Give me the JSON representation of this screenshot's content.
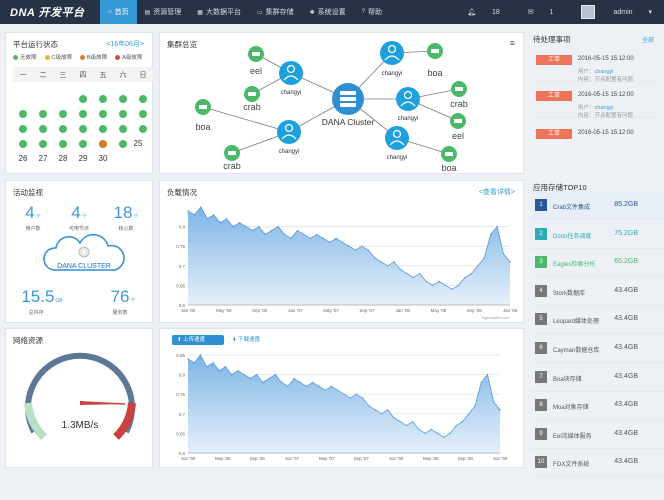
{
  "brand": {
    "logo": "DNA 开发平台"
  },
  "nav": [
    {
      "label": "首页",
      "icon": "home-icon"
    },
    {
      "label": "资源管理",
      "icon": "server-icon"
    },
    {
      "label": "大数据平台",
      "icon": "grid-icon"
    },
    {
      "label": "集群存储",
      "icon": "storage-icon"
    },
    {
      "label": "系统设置",
      "icon": "gear-icon"
    },
    {
      "label": "帮助",
      "icon": "help-icon"
    }
  ],
  "topbar": {
    "notifications": "18",
    "messages": "1",
    "user": "admin"
  },
  "calendar": {
    "title": "平台运行状态",
    "month": "<16年06月>",
    "legend": [
      "无故障",
      "C级故障",
      "B级故障",
      "A级故障"
    ],
    "legend_colors": [
      "#4cb96a",
      "#f2b035",
      "#e07b2a",
      "#d64b3b"
    ],
    "weekdays": [
      "一",
      "二",
      "三",
      "四",
      "五",
      "六",
      "日"
    ],
    "numbers": [
      "25",
      "26",
      "27",
      "28",
      "29",
      "30"
    ]
  },
  "cluster": {
    "title": "集群总览",
    "center": "DANA Cluster",
    "node_labels": [
      "changyi",
      "changyi",
      "changyi",
      "changyi",
      "changyi"
    ],
    "leaf_labels": [
      "eel",
      "crab",
      "boa",
      "crab",
      "boa",
      "crab",
      "eel",
      "boa"
    ]
  },
  "todo": {
    "title": "待处理事项",
    "more": "全部",
    "items": [
      {
        "badge": "工单",
        "date": "2016-05-15 15:12:00",
        "user_label": "用户：",
        "user": "changyi",
        "content": "内容：节点配置有问题"
      },
      {
        "badge": "工单",
        "date": "2016-05-15 15:12:00",
        "user_label": "用户：",
        "user": "changyi",
        "content": "内容：节点配置有问题"
      },
      {
        "badge": "工单",
        "date": "2016-05-15 15:12:00"
      }
    ]
  },
  "activity": {
    "title": "活动监视",
    "stats": [
      {
        "value": "4",
        "unit": "个",
        "label": "用户数"
      },
      {
        "value": "4",
        "unit": "个",
        "label": "可用节点"
      },
      {
        "value": "18",
        "unit": "个",
        "label": "核心数"
      },
      {
        "value": "15.5",
        "unit": "GB",
        "label": "总内存"
      },
      {
        "value": "76",
        "unit": "个",
        "label": "服务数"
      }
    ],
    "cloud_label": "DANA CLUSTER"
  },
  "load": {
    "title": "负载情况",
    "link": "<查看详情>",
    "credit": "highcharts.com"
  },
  "chart_data": [
    {
      "type": "area",
      "title": "负载情况",
      "x_ticks": [
        "Jan '06",
        "May '06",
        "Sep '06",
        "Jan '07",
        "May '07",
        "Sep '07",
        "Jan '08",
        "May '08",
        "Sep '08",
        "Jan '09"
      ],
      "yticks": [
        "0.8",
        "0.75",
        "0.7",
        "0.65",
        "0.6"
      ],
      "ylim": [
        0.6,
        0.85
      ],
      "values": [
        0.84,
        0.83,
        0.85,
        0.82,
        0.83,
        0.81,
        0.82,
        0.8,
        0.81,
        0.8,
        0.79,
        0.8,
        0.78,
        0.79,
        0.8,
        0.78,
        0.77,
        0.79,
        0.78,
        0.77,
        0.78,
        0.77,
        0.76,
        0.77,
        0.76,
        0.75,
        0.74,
        0.75,
        0.74,
        0.72,
        0.71,
        0.7,
        0.71,
        0.69,
        0.68,
        0.67,
        0.68,
        0.66,
        0.65,
        0.66,
        0.65,
        0.64,
        0.65,
        0.67,
        0.68,
        0.7,
        0.72,
        0.78,
        0.8,
        0.73,
        0.71
      ]
    },
    {
      "type": "area",
      "title": "",
      "x_ticks": [
        "Jan '06",
        "May '06",
        "Sep '06",
        "Jan '07",
        "May '07",
        "Sep '07",
        "Jan '08",
        "May '08",
        "Sep '08",
        "Jan '09"
      ],
      "yticks": [
        "0.85",
        "0.8",
        "0.75",
        "0.7",
        "0.65",
        "0.6"
      ],
      "ylim": [
        0.6,
        0.85
      ],
      "values": [
        0.84,
        0.83,
        0.85,
        0.82,
        0.83,
        0.81,
        0.82,
        0.8,
        0.81,
        0.8,
        0.79,
        0.8,
        0.78,
        0.79,
        0.8,
        0.78,
        0.77,
        0.79,
        0.78,
        0.77,
        0.78,
        0.77,
        0.76,
        0.77,
        0.76,
        0.75,
        0.74,
        0.75,
        0.74,
        0.72,
        0.71,
        0.7,
        0.71,
        0.69,
        0.68,
        0.67,
        0.68,
        0.66,
        0.65,
        0.66,
        0.65,
        0.64,
        0.65,
        0.67,
        0.68,
        0.7,
        0.72,
        0.78,
        0.8,
        0.73,
        0.71
      ]
    }
  ],
  "network": {
    "title": "网络资源",
    "speed": "1.3MB/s",
    "speed_value": 0.65,
    "upload": "上传速度",
    "download": "下载速度"
  },
  "ranking": {
    "title": "应用存储TOP10",
    "items": [
      {
        "n": "1",
        "name": "Crab文件集成",
        "size": "85.2GB",
        "color": "#2b5797"
      },
      {
        "n": "2",
        "name": "Dodo任务调度",
        "size": "75.2GB",
        "color": "#31a9b8"
      },
      {
        "n": "3",
        "name": "Eagles检索分析",
        "size": "65.2GB",
        "color": "#4cb96a"
      },
      {
        "n": "4",
        "name": "Stork数据库",
        "size": "43.4GB",
        "color": "#777777"
      },
      {
        "n": "5",
        "name": "Leopard媒体处理",
        "size": "43.4GB",
        "color": "#777777"
      },
      {
        "n": "6",
        "name": "Cayman数据仓库",
        "size": "43.4GB",
        "color": "#777777"
      },
      {
        "n": "7",
        "name": "Boa块存储",
        "size": "43.4GB",
        "color": "#777777"
      },
      {
        "n": "8",
        "name": "Moa对象存储",
        "size": "43.4GB",
        "color": "#777777"
      },
      {
        "n": "9",
        "name": "Eel流媒体服务",
        "size": "43.4GB",
        "color": "#777777"
      },
      {
        "n": "10",
        "name": "FOX文件系统",
        "size": "43.4GB",
        "color": "#777777"
      }
    ]
  }
}
